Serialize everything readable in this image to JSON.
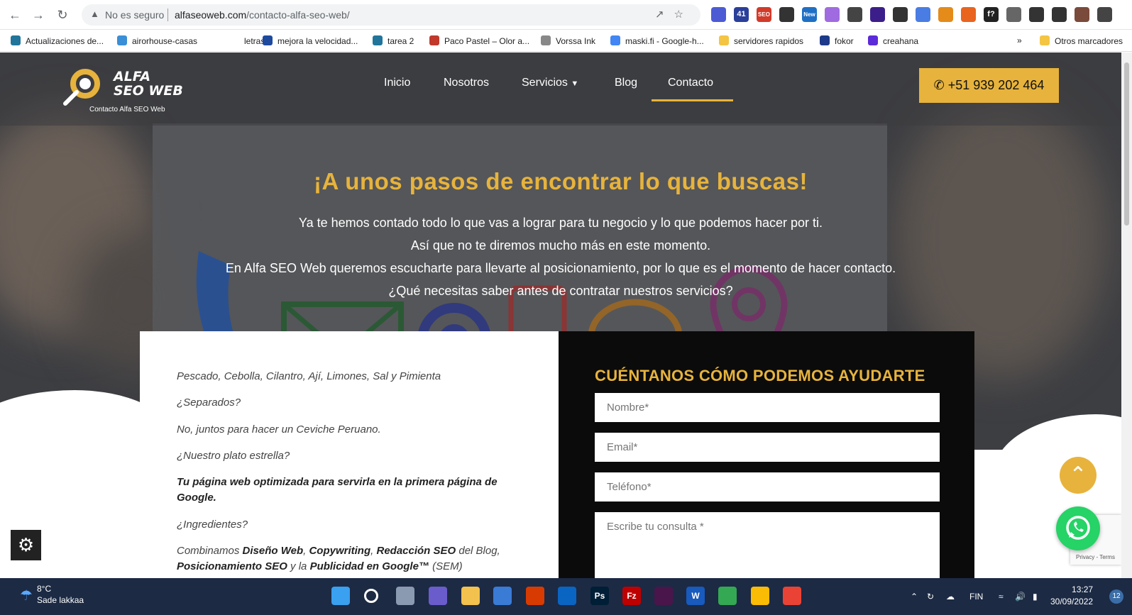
{
  "browser": {
    "security_label": "No es seguro",
    "url_host": "alfaseoweb.com",
    "url_path": "/contacto-alfa-seo-web/",
    "extensions": [
      {
        "icon": "ext-flower-icon",
        "color": "#4c5bd4"
      },
      {
        "icon": "ext-grad-icon",
        "color": "#2a3f9a",
        "badge": "41"
      },
      {
        "icon": "ext-seo-icon",
        "color": "#d23a2a",
        "badge": "SEO"
      },
      {
        "icon": "ext-pen-icon",
        "color": "#333333"
      },
      {
        "icon": "ext-new-icon",
        "color": "#1f6fc5",
        "badge": "New"
      },
      {
        "icon": "ext-puzzle-icon",
        "color": "#a06be0"
      },
      {
        "icon": "ext-doc-icon",
        "color": "#444444"
      },
      {
        "icon": "ext-image-icon",
        "color": "#3c1e8a"
      },
      {
        "icon": "ext-scissor-icon",
        "color": "#333333"
      },
      {
        "icon": "ext-translate-icon",
        "color": "#4a7de3"
      },
      {
        "icon": "ext-sun-icon",
        "color": "#e48b1a"
      },
      {
        "icon": "ext-reddit-icon",
        "color": "#e8641f"
      },
      {
        "icon": "ext-font-icon",
        "color": "#222222",
        "badge": "f?"
      },
      {
        "icon": "ext-camera-icon",
        "color": "#666666"
      },
      {
        "icon": "extensions-icon",
        "color": "#333333"
      },
      {
        "icon": "sidepanel-icon",
        "color": "#333333"
      },
      {
        "icon": "profile-avatar",
        "color": "#7a4a3a"
      },
      {
        "icon": "menu-kebab-icon",
        "color": "#444444"
      }
    ]
  },
  "bookmarks": {
    "items": [
      {
        "label": "Actualizaciones de...",
        "color": "#21759b"
      },
      {
        "label": "airorhouse-casas",
        "color": "#3a8fd6"
      },
      {
        "label": "letras",
        "color": "#ffffff"
      },
      {
        "label": "mejora la velocidad...",
        "color": "#1e4a9e"
      },
      {
        "label": "tarea 2",
        "color": "#21759b"
      },
      {
        "label": "Paco Pastel – Olor a...",
        "color": "#c0392b"
      },
      {
        "label": "Vorssa Ink",
        "color": "#888888"
      },
      {
        "label": "maski.fi - Google-h...",
        "color": "#4285f4"
      },
      {
        "label": "servidores rapidos",
        "color": "#f4c542"
      },
      {
        "label": "fokor",
        "color": "#1d3a8a"
      },
      {
        "label": "creahana",
        "color": "#5b2bd9"
      }
    ],
    "more": "»",
    "other": "Otros marcadores"
  },
  "site": {
    "logo_line1": "ALFA",
    "logo_line2": "SEO WEB",
    "logo_tagline": "Contacto Alfa SEO Web",
    "menu": [
      {
        "label": "Inicio"
      },
      {
        "label": "Nosotros"
      },
      {
        "label": "Servicios"
      },
      {
        "label": "Blog"
      },
      {
        "label": "Contacto"
      }
    ],
    "phone": "+51 939 202 464",
    "accent": "#e7b33c",
    "headline": "¡A unos pasos de encontrar lo que buscas!",
    "intro": [
      "Ya te hemos contado todo lo que vas a lograr para tu negocio y lo que podemos hacer por ti.",
      "Así que no te diremos mucho más en este momento.",
      "En Alfa SEO Web queremos escucharte para llevarte al posicionamiento, por lo que es el momento de hacer contacto.",
      "¿Qué necesitas saber antes de contratar nuestros servicios?"
    ],
    "story": {
      "p1": "Pescado, Cebolla, Cilantro, Ají, Limones, Sal y Pimienta",
      "p2": "¿Separados?",
      "p3": "No, juntos para hacer un Ceviche Peruano.",
      "p4": "¿Nuestro plato estrella?",
      "p5": "Tu página web optimizada para servirla en la primera página de Google.",
      "p6": "¿Ingredientes?",
      "p7_a": "Combinamos ",
      "p7_b": "Diseño Web",
      "p7_c": ", ",
      "p7_d": "Copywriting",
      "p7_e": ", ",
      "p7_f": "Redacción SEO",
      "p7_g": " del Blog,",
      "p8_a": "Posicionamiento SEO",
      "p8_b": " y la ",
      "p8_c": "Publicidad en Google™",
      "p8_d": " (SEM)"
    },
    "form": {
      "title": "CUÉNTANOS CÓMO PODEMOS AYUDARTE",
      "name_placeholder": "Nombre*",
      "email_placeholder": "Email*",
      "phone_placeholder": "Teléfono*",
      "message_placeholder": "Escribe tu consulta *"
    },
    "captcha_text": "Privacy - Terms"
  },
  "taskbar": {
    "temperature": "8°C",
    "weather": "Sade lakkaa",
    "language": "FIN",
    "time": "13:27",
    "date": "30/09/2022",
    "notifications": "12",
    "apps": [
      {
        "icon": "windows-start-icon",
        "color": "#3aa0f0"
      },
      {
        "icon": "search-icon",
        "color": "#1c2a44"
      },
      {
        "icon": "task-view-icon",
        "color": "#8a9ab0"
      },
      {
        "icon": "teams-chat-icon",
        "color": "#6b5ccc"
      },
      {
        "icon": "file-explorer-icon",
        "color": "#f2c14e"
      },
      {
        "icon": "microsoft-store-icon",
        "color": "#3a7bd5"
      },
      {
        "icon": "office-icon",
        "color": "#d83b01"
      },
      {
        "icon": "outlook-icon",
        "color": "#0a64c2"
      },
      {
        "icon": "photoshop-icon",
        "color": "#001e36",
        "label": "Ps"
      },
      {
        "icon": "filezilla-icon",
        "color": "#bf0000",
        "label": "Fz"
      },
      {
        "icon": "slack-icon",
        "color": "#4a154b"
      },
      {
        "icon": "word-icon",
        "color": "#185abd",
        "label": "W"
      },
      {
        "icon": "chrome-icon",
        "color": "#34a853"
      },
      {
        "icon": "chrome-profile-icon",
        "color": "#fbbc05"
      },
      {
        "icon": "chrome-active-icon",
        "color": "#ea4335"
      }
    ]
  }
}
